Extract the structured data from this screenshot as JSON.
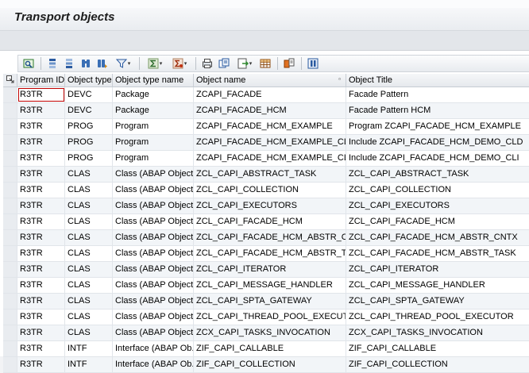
{
  "window": {
    "title": "Transport objects"
  },
  "toolbar": {
    "buttons": [
      {
        "name": "details-icon"
      },
      {
        "name": "sort-ascending-icon"
      },
      {
        "name": "sort-descending-icon"
      },
      {
        "name": "find-icon"
      },
      {
        "name": "find-next-icon"
      },
      {
        "name": "filter-icon",
        "menu": true
      },
      {
        "name": "sum-icon",
        "menu": true
      },
      {
        "name": "subtotals-icon",
        "menu": true
      },
      {
        "name": "print-preview-icon"
      },
      {
        "name": "export-icon",
        "menu": true
      },
      {
        "name": "spreadsheet-icon"
      },
      {
        "name": "change-layout-icon"
      },
      {
        "name": "choose-layout-icon"
      },
      {
        "name": "graphic-icon"
      }
    ]
  },
  "table": {
    "columns": [
      "Program ID",
      "Object type",
      "Object type name",
      "Object name",
      "Object Title"
    ],
    "rows": [
      [
        "R3TR",
        "DEVC",
        "Package",
        "ZCAPI_FACADE",
        "Facade Pattern"
      ],
      [
        "R3TR",
        "DEVC",
        "Package",
        "ZCAPI_FACADE_HCM",
        "Facade Pattern HCM"
      ],
      [
        "R3TR",
        "PROG",
        "Program",
        "ZCAPI_FACADE_HCM_EXAMPLE",
        "Program ZCAPI_FACADE_HCM_EXAMPLE"
      ],
      [
        "R3TR",
        "PROG",
        "Program",
        "ZCAPI_FACADE_HCM_EXAMPLE_CLD",
        "Include ZCAPI_FACADE_HCM_DEMO_CLD"
      ],
      [
        "R3TR",
        "PROG",
        "Program",
        "ZCAPI_FACADE_HCM_EXAMPLE_CLI",
        "Include ZCAPI_FACADE_HCM_DEMO_CLI"
      ],
      [
        "R3TR",
        "CLAS",
        "Class (ABAP Objects)",
        "ZCL_CAPI_ABSTRACT_TASK",
        "ZCL_CAPI_ABSTRACT_TASK"
      ],
      [
        "R3TR",
        "CLAS",
        "Class (ABAP Objects)",
        "ZCL_CAPI_COLLECTION",
        "ZCL_CAPI_COLLECTION"
      ],
      [
        "R3TR",
        "CLAS",
        "Class (ABAP Objects)",
        "ZCL_CAPI_EXECUTORS",
        "ZCL_CAPI_EXECUTORS"
      ],
      [
        "R3TR",
        "CLAS",
        "Class (ABAP Objects)",
        "ZCL_CAPI_FACADE_HCM",
        "ZCL_CAPI_FACADE_HCM"
      ],
      [
        "R3TR",
        "CLAS",
        "Class (ABAP Objects)",
        "ZCL_CAPI_FACADE_HCM_ABSTR_CNTX",
        "ZCL_CAPI_FACADE_HCM_ABSTR_CNTX"
      ],
      [
        "R3TR",
        "CLAS",
        "Class (ABAP Objects)",
        "ZCL_CAPI_FACADE_HCM_ABSTR_TASK",
        "ZCL_CAPI_FACADE_HCM_ABSTR_TASK"
      ],
      [
        "R3TR",
        "CLAS",
        "Class (ABAP Objects)",
        "ZCL_CAPI_ITERATOR",
        "ZCL_CAPI_ITERATOR"
      ],
      [
        "R3TR",
        "CLAS",
        "Class (ABAP Objects)",
        "ZCL_CAPI_MESSAGE_HANDLER",
        "ZCL_CAPI_MESSAGE_HANDLER"
      ],
      [
        "R3TR",
        "CLAS",
        "Class (ABAP Objects)",
        "ZCL_CAPI_SPTA_GATEWAY",
        "ZCL_CAPI_SPTA_GATEWAY"
      ],
      [
        "R3TR",
        "CLAS",
        "Class (ABAP Objects)",
        "ZCL_CAPI_THREAD_POOL_EXECUTOR",
        "ZCL_CAPI_THREAD_POOL_EXECUTOR"
      ],
      [
        "R3TR",
        "CLAS",
        "Class (ABAP Objects)",
        "ZCX_CAPI_TASKS_INVOCATION",
        "ZCX_CAPI_TASKS_INVOCATION"
      ],
      [
        "R3TR",
        "INTF",
        "Interface (ABAP Ob...",
        "ZIF_CAPI_CALLABLE",
        "ZIF_CAPI_CALLABLE"
      ],
      [
        "R3TR",
        "INTF",
        "Interface (ABAP Ob...",
        "ZIF_CAPI_COLLECTION",
        "ZIF_CAPI_COLLECTION"
      ]
    ]
  }
}
